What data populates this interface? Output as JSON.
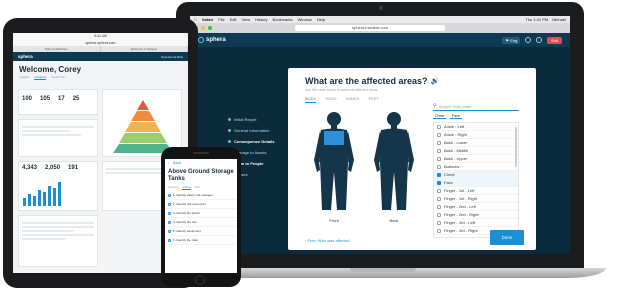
{
  "laptop": {
    "menubar": {
      "app": "Safari",
      "items": [
        "File",
        "Edit",
        "View",
        "History",
        "Bookmarks",
        "Window",
        "Help"
      ],
      "clock": "Thu 1:41 PM",
      "user": "Michael"
    },
    "browser": {
      "url": "sphera.incident.com"
    },
    "header": {
      "brand": "sphera",
      "language": "Eng",
      "exit": "Exit"
    },
    "steps": [
      {
        "label": "Initial Report",
        "active": false
      },
      {
        "label": "General Information",
        "active": false
      },
      {
        "label": "Consequence Details",
        "active": true
      },
      {
        "label": "Damage to Assets",
        "active": false
      },
      {
        "label": "Harm to People",
        "active": true
      },
      {
        "label": "Causes",
        "active": false
      }
    ],
    "modal": {
      "title": "What are the affected areas?",
      "subtitle": "Use the chart below to select all affected areas",
      "view_tabs": [
        "BODY",
        "HEAD",
        "HANDS",
        "FEET"
      ],
      "active_view": "BODY",
      "front_label": "Front",
      "back_label": "Back",
      "search_placeholder": "Search body parts...",
      "filters": [
        "Chest",
        "Face"
      ],
      "body_parts": [
        {
          "label": "Ankle - Left",
          "checked": false
        },
        {
          "label": "Ankle - Right",
          "checked": false
        },
        {
          "label": "Back - Lower",
          "checked": false
        },
        {
          "label": "Back - Middle",
          "checked": false
        },
        {
          "label": "Back - Upper",
          "checked": false
        },
        {
          "label": "Buttocks",
          "checked": false
        },
        {
          "label": "Chest",
          "checked": true
        },
        {
          "label": "Face",
          "checked": true
        },
        {
          "label": "Finger - 1st - Left",
          "checked": false
        },
        {
          "label": "Finger - 1st - Right",
          "checked": false
        },
        {
          "label": "Finger - 2nd - Left",
          "checked": false
        },
        {
          "label": "Finger - 2nd - Right",
          "checked": false
        },
        {
          "label": "Finger - 3rd - Left",
          "checked": false
        },
        {
          "label": "Finger - 3rd - Right",
          "checked": false
        }
      ],
      "prev_link": "Prev: Who was affected",
      "done_label": "Done"
    }
  },
  "tablet": {
    "status": "9:41 AM",
    "url": "sphera.sphera.com",
    "browser_tabs": [
      "Sphera Solutions",
      "Welcome to Sphera"
    ],
    "brand": "sphera",
    "header_right": "Operational Risk",
    "welcome": "Welcome, Corey",
    "tabs": [
      "Insights",
      "Incidents",
      "Audit Plan"
    ],
    "cards": {
      "summary_nums": [
        "100",
        "105",
        "17",
        "25"
      ],
      "lower_nums": [
        "4,343",
        "2,050",
        "191"
      ]
    }
  },
  "phone": {
    "back": "Back",
    "title": "Above Ground Storage Tanks",
    "tabs": [
      "Overview",
      "Actions",
      "Docs"
    ],
    "items": [
      "1. Identify safety risk manager",
      "2. Identify site personnel",
      "3. Identify the actors",
      "4. Identify the risk",
      "5. Identify equipment",
      "6. Identify the risks"
    ]
  }
}
